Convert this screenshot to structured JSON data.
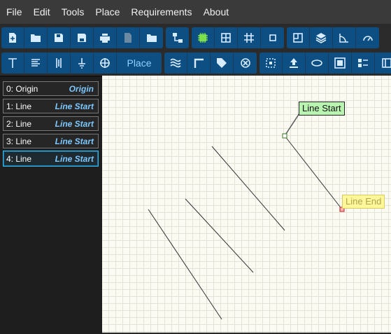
{
  "menu": [
    "File",
    "Edit",
    "Tools",
    "Place",
    "Requirements",
    "About"
  ],
  "toolbar2": {
    "place_label": "Place"
  },
  "segments": [
    {
      "label": "0: Origin",
      "type": "Origin"
    },
    {
      "label": "1: Line",
      "type": "Line Start"
    },
    {
      "label": "2: Line",
      "type": "Line Start"
    },
    {
      "label": "3: Line",
      "type": "Line Start"
    },
    {
      "label": "4: Line",
      "type": "Line Start"
    }
  ],
  "canvas": {
    "start_label": "Line Start",
    "end_label": "Line End"
  },
  "colors": {
    "accent": "#0d4f83",
    "selected_border": "#2fb7e8",
    "start_tag": "#b9f5b0",
    "end_tag": "#fff79a"
  }
}
